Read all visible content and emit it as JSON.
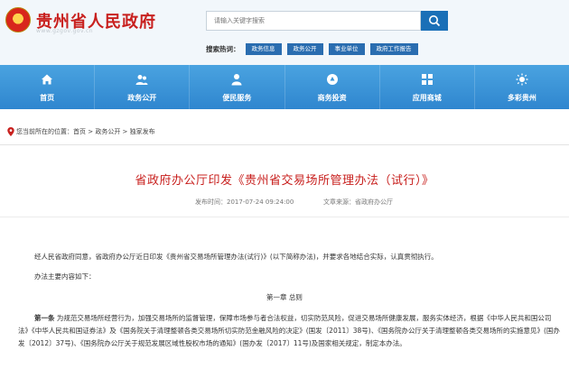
{
  "site": {
    "title": "贵州省人民政府",
    "url": "www.gzgov.gov.cn"
  },
  "search": {
    "placeholder": "请输入关键字搜索",
    "hot_label": "搜索热词：",
    "hot_tags": [
      "政务信息",
      "政务公开",
      "事业单位",
      "政府工作报告"
    ]
  },
  "nav": [
    {
      "label": "首页",
      "icon": "home-icon"
    },
    {
      "label": "政务公开",
      "icon": "people-icon"
    },
    {
      "label": "便民服务",
      "icon": "person-service-icon"
    },
    {
      "label": "商务投资",
      "icon": "business-icon"
    },
    {
      "label": "应用商城",
      "icon": "apps-grid-icon"
    },
    {
      "label": "多彩贵州",
      "icon": "sun-icon"
    }
  ],
  "breadcrumb": {
    "prefix": "您当前所在的位置：",
    "items": [
      "首页",
      "政务公开",
      "独家发布"
    ],
    "separator": " > "
  },
  "article": {
    "title": "省政府办公厅印发《贵州省交易场所管理办法（试行）》",
    "date_label": "发布时间：",
    "date": "2017-07-24 09:24:00",
    "source_label": "文章来源：",
    "source": "省政府办公厅",
    "p1": "经人民省政府同意，省政府办公厅近日印发《贵州省交易场所管理办法(试行)》(以下简称办法)，并要求各地结合实际，认真贯彻执行。",
    "p2": "办法主要内容如下：",
    "chapter": "第一章 总则",
    "p3_lead": "第一条",
    "p3_body": " 为规范交易场所经营行为，加强交易场所的监督管理，保障市场参与者合法权益，切实防范风险，促进交易场所健康发展，服务实体经济，根据《中华人民共和国公司法》《中华人民共和国证券法》及《国务院关于清理整顿各类交易场所切实防范金融风险的决定》(国发〔2011〕38号)、《国务院办公厅关于清理整顿各类交易场所的实施意见》(国办发〔2012〕37号)、《国务院办公厅关于规范发展区域性股权市场的通知》(国办发〔2017〕11号)及国家相关规定，制定本办法。"
  },
  "colors": {
    "brand_red": "#c8201e",
    "nav_blue": "#3a94d8",
    "tag_blue": "#2a6db0"
  }
}
